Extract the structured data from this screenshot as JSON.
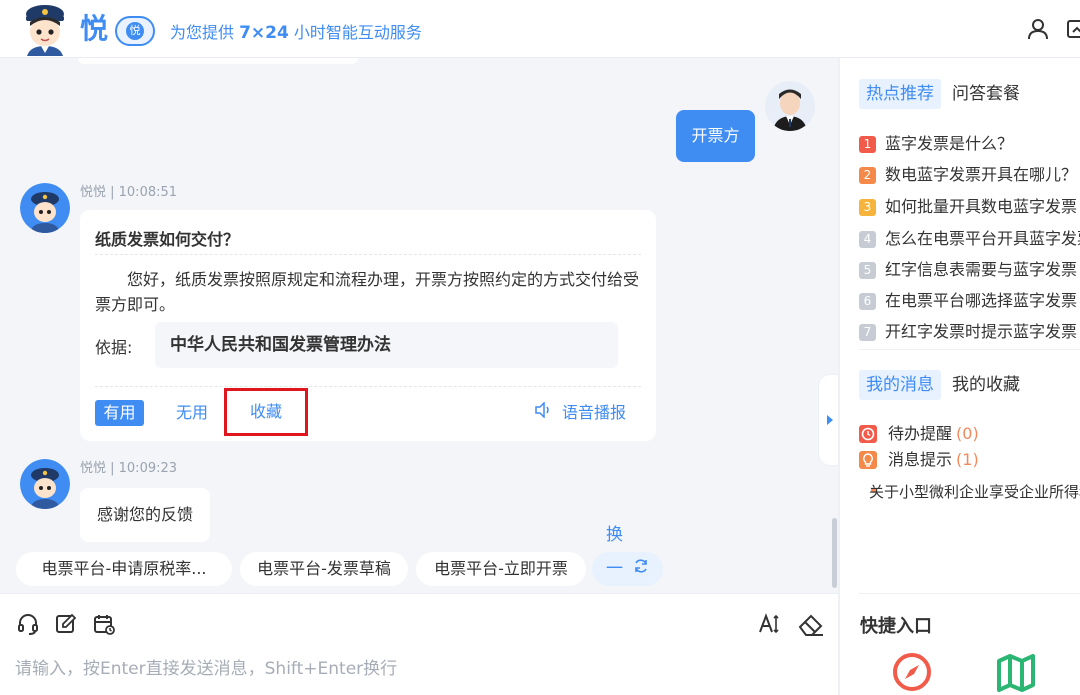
{
  "header": {
    "logo_text": "悦",
    "logo_badge": "悦",
    "slogan_prefix": "为您提供 ",
    "slogan_bold": "7×24",
    "slogan_suffix": " 小时智能互动服务",
    "icons": [
      "user-icon",
      "window-icon"
    ]
  },
  "chat": {
    "user_message": "开票方",
    "bot_reply": {
      "meta": "悦悦 | 10:08:51",
      "question": "纸质发票如何交付？",
      "answer": "您好，纸质发票按照原规定和流程办理，开票方按照约定的方式交付给受票方即可。",
      "basis_label": "依据:",
      "basis_value": "中华人民共和国发票管理办法",
      "actions": {
        "useful": "有用",
        "useless": "无用",
        "favorite": "收藏",
        "voice": "语音播报"
      }
    },
    "thanks_reply": {
      "meta": "悦悦 | 10:09:23",
      "text": "感谢您的反馈"
    },
    "suggestions": [
      "电票平台-申请原税率...",
      "电票平台-发票草稿",
      "电票平台-立即开票"
    ],
    "refresh_label": "换一批"
  },
  "input": {
    "placeholder": "请输入，按Enter直接发送消息，Shift+Enter换行",
    "value": "",
    "font_size_label": "A",
    "icons": [
      "headset-icon",
      "edit-icon",
      "calendar-icon",
      "font-size-icon",
      "eraser-icon"
    ]
  },
  "right_panel": {
    "tabs_top": {
      "active": "热点推荐",
      "other": "问答套餐"
    },
    "hot_list": [
      {
        "rank": "1",
        "text": "蓝字发票是什么？",
        "color": "#f25a4a"
      },
      {
        "rank": "2",
        "text": "数电蓝字发票开具在哪儿？",
        "color": "#f5894a"
      },
      {
        "rank": "3",
        "text": "如何批量开具数电蓝字发票",
        "color": "#f6b43d"
      },
      {
        "rank": "4",
        "text": "怎么在电票平台开具蓝字发票",
        "color": "#c7ccd4"
      },
      {
        "rank": "5",
        "text": "红字信息表需要与蓝字发票",
        "color": "#c7ccd4"
      },
      {
        "rank": "6",
        "text": "在电票平台哪选择蓝字发票",
        "color": "#c7ccd4"
      },
      {
        "rank": "7",
        "text": "开红字发票时提示蓝字发票",
        "color": "#c7ccd4"
      }
    ],
    "tabs_mid": {
      "active": "我的消息",
      "other": "我的收藏"
    },
    "messages": [
      {
        "label": "待办提醒",
        "count": "(0)",
        "icon": "clock-icon",
        "color": "#f25a4a"
      },
      {
        "label": "消息提示",
        "count": "(1)",
        "icon": "bulb-icon",
        "color": "#f5894a"
      }
    ],
    "notice": "关于小型微利企业享受企业所得税优惠政策",
    "quick_entry_title": "快捷入口",
    "quick_icons": [
      "compass-icon",
      "map-icon"
    ]
  },
  "colors": {
    "primary": "#3f8cf3",
    "highlight_border": "#e0161e",
    "chat_bg": "#f3f5f9"
  }
}
